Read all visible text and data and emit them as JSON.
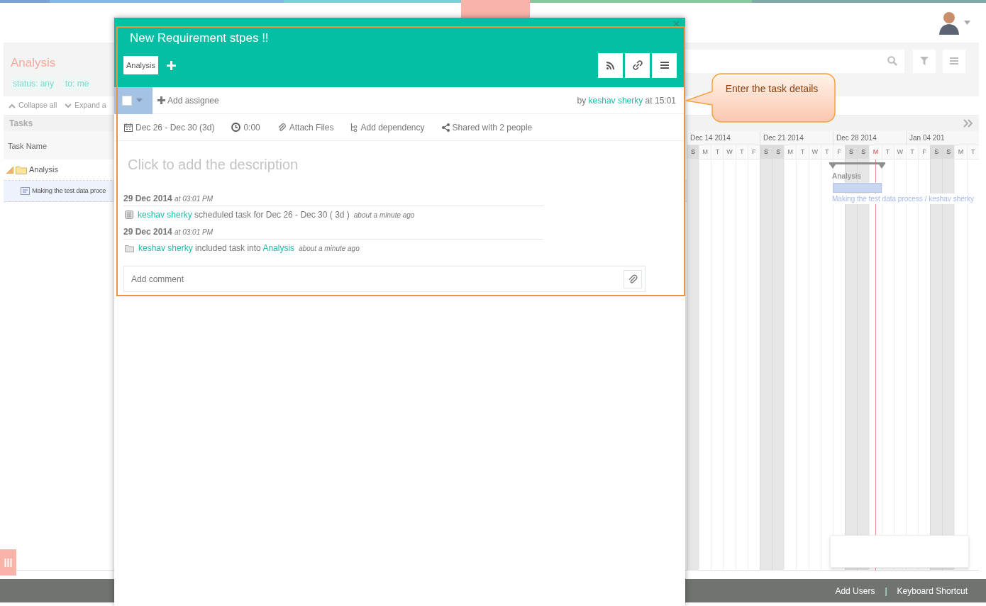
{
  "header": {
    "avatar_menu": {
      "expanded": false
    }
  },
  "project": {
    "title": "Analysis",
    "filters": [
      "status: any",
      "to: me"
    ]
  },
  "tree_toolbar": [
    {
      "label": "Collapse all",
      "kind": "collapse"
    },
    {
      "label": "Expand a",
      "kind": "expand"
    }
  ],
  "tasks_panel": {
    "title": "Tasks",
    "column": "Task Name",
    "rows": [
      {
        "name": "Analysis",
        "kind": "folder",
        "selected": false,
        "expanded": true,
        "children": [
          {
            "name": "Making the test data proce",
            "kind": "task",
            "selected": true
          }
        ]
      }
    ]
  },
  "gantt": {
    "weeks": [
      "Dec 14 2014",
      "Dec 21 2014",
      "Dec 28 2014",
      "Jan 04 201"
    ],
    "days": [
      {
        "label": "S",
        "weekend": true,
        "today": false
      },
      {
        "label": "M",
        "weekend": false,
        "today": false
      },
      {
        "label": "T",
        "weekend": false,
        "today": false
      },
      {
        "label": "W",
        "weekend": false,
        "today": false
      },
      {
        "label": "T",
        "weekend": false,
        "today": false
      },
      {
        "label": "F",
        "weekend": false,
        "today": false
      },
      {
        "label": "S",
        "weekend": true,
        "today": false
      },
      {
        "label": "S",
        "weekend": true,
        "today": false
      },
      {
        "label": "M",
        "weekend": false,
        "today": false
      },
      {
        "label": "T",
        "weekend": false,
        "today": false
      },
      {
        "label": "W",
        "weekend": false,
        "today": false
      },
      {
        "label": "T",
        "weekend": false,
        "today": false
      },
      {
        "label": "F",
        "weekend": false,
        "today": false
      },
      {
        "label": "S",
        "weekend": true,
        "today": false
      },
      {
        "label": "S",
        "weekend": true,
        "today": false
      },
      {
        "label": "M",
        "weekend": false,
        "today": true
      },
      {
        "label": "T",
        "weekend": false,
        "today": false
      },
      {
        "label": "W",
        "weekend": false,
        "today": false
      },
      {
        "label": "T",
        "weekend": false,
        "today": false
      },
      {
        "label": "F",
        "weekend": false,
        "today": false
      },
      {
        "label": "S",
        "weekend": true,
        "today": false
      },
      {
        "label": "S",
        "weekend": true,
        "today": false
      },
      {
        "label": "M",
        "weekend": false,
        "today": false
      },
      {
        "label": "T",
        "weekend": false,
        "today": false
      }
    ],
    "summary_label": "Analysis",
    "task_label": "Making the test data process / keshav sherky"
  },
  "modal": {
    "title": "New Requirement stpes !!",
    "tags": [
      "Analysis"
    ],
    "status": {
      "checked": false
    },
    "add_assignee": "Add assignee",
    "author": {
      "prefix": "by",
      "user": "keshav sherky",
      "suffix": "at 15:01"
    },
    "details": [
      {
        "kind": "date",
        "label": "Dec 26 - Dec 30 (3d)"
      },
      {
        "kind": "time",
        "label": "0:00"
      },
      {
        "kind": "attach",
        "label": "Attach Files"
      },
      {
        "kind": "dependency",
        "label": "Add dependency"
      },
      {
        "kind": "share",
        "label": "Shared with 2 people"
      }
    ],
    "description": {
      "placeholder": "Click to add the description"
    },
    "activity": [
      {
        "date": "29 Dec 2014",
        "time": "at 03:01 PM",
        "kind": "schedule",
        "user": "keshav sherky",
        "text": "scheduled task for Dec 26 - Dec 30 ( 3d )",
        "ago": "about a minute ago"
      },
      {
        "date": "29 Dec 2014",
        "time": "at 03:01 PM",
        "kind": "folder",
        "user": "keshav sherky",
        "text": "included task into",
        "link": "Analysis",
        "ago": "about a minute ago"
      }
    ],
    "comment": {
      "placeholder": "Add comment"
    }
  },
  "callout": {
    "text": "Enter the task details"
  },
  "footer": {
    "links": [
      "Add Users",
      "Keyboard Shortcut"
    ],
    "separator": "|"
  }
}
